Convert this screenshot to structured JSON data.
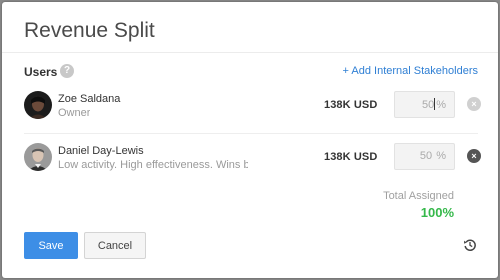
{
  "dialog": {
    "title": "Revenue Split"
  },
  "users_section": {
    "heading": "Users",
    "help_icon": "?",
    "add_link": "+ Add Internal Stakeholders"
  },
  "users": [
    {
      "name": "Zoe Saldana",
      "subtitle": "Owner",
      "amount": "138K USD",
      "percent": "50",
      "unit": "%",
      "remove_icon": "×"
    },
    {
      "name": "Daniel Day-Lewis",
      "subtitle": "Low activity. High effectiveness. Wins bi...",
      "amount": "138K USD",
      "percent": "50",
      "unit": "%",
      "remove_icon": "×"
    }
  ],
  "totals": {
    "label": "Total Assigned",
    "value": "100%"
  },
  "footer": {
    "save_label": "Save",
    "cancel_label": "Cancel"
  },
  "colors": {
    "accent": "#3d8ee6",
    "link": "#2f7fd4",
    "success": "#35b84a"
  },
  "icons": {
    "help": "help-icon",
    "remove": "close-icon",
    "history": "history-icon"
  }
}
